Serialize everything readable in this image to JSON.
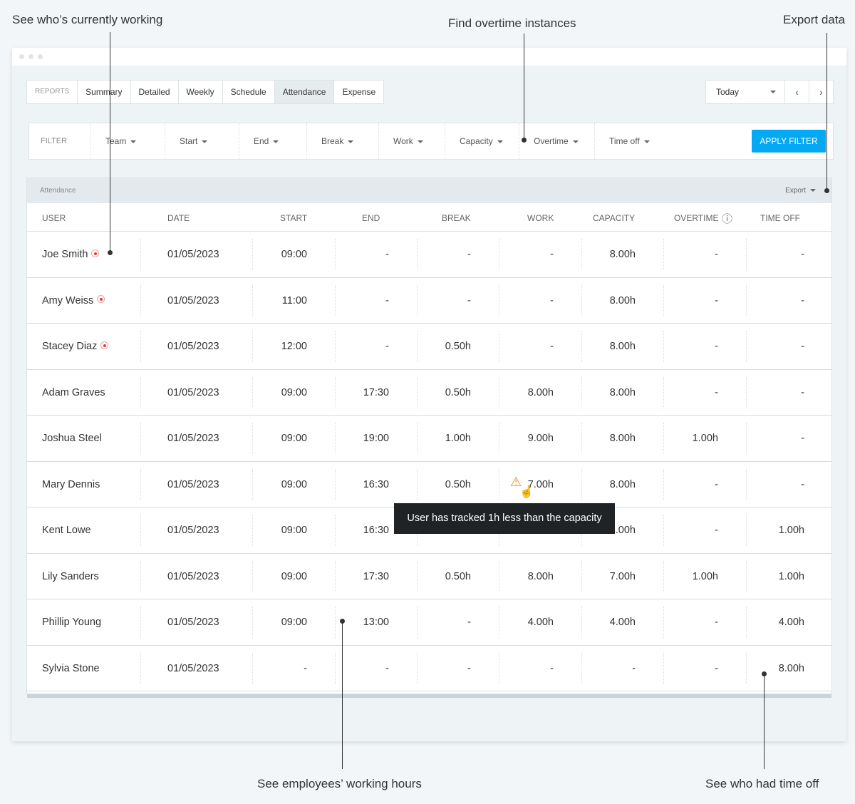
{
  "annotations": {
    "working": "See who’s currently working",
    "overtime": "Find overtime instances",
    "export": "Export data",
    "hours": "See employees’ working hours",
    "timeoff": "See who had time off"
  },
  "tabs": {
    "label": "REPORTS",
    "items": [
      "Summary",
      "Detailed",
      "Weekly",
      "Schedule",
      "Attendance",
      "Expense"
    ],
    "active": "Attendance"
  },
  "date_picker": {
    "value": "Today",
    "prev": "‹",
    "next": "›"
  },
  "filter": {
    "label": "FILTER",
    "items": [
      "Team",
      "Start",
      "End",
      "Break",
      "Work",
      "Capacity",
      "Overtime",
      "Time off"
    ],
    "apply": "APPLY FILTER",
    "accent": "#03a9f4"
  },
  "table": {
    "title": "Attendance",
    "export": "Export",
    "columns": [
      "USER",
      "DATE",
      "START",
      "END",
      "BREAK",
      "WORK",
      "CAPACITY",
      "OVERTIME",
      "TIME OFF"
    ],
    "rows": [
      {
        "user": "Joe Smith",
        "live": true,
        "cells": [
          "01/05/2023",
          "09:00",
          "-",
          "-",
          "-",
          "8.00h",
          "-",
          "-"
        ]
      },
      {
        "user": "Amy Weiss",
        "live": true,
        "cells": [
          "01/05/2023",
          "11:00",
          "-",
          "-",
          "-",
          "8.00h",
          "-",
          "-"
        ]
      },
      {
        "user": "Stacey Diaz",
        "live": true,
        "cells": [
          "01/05/2023",
          "12:00",
          "-",
          "0.50h",
          "-",
          "8.00h",
          "-",
          "-"
        ]
      },
      {
        "user": "Adam Graves",
        "live": false,
        "cells": [
          "01/05/2023",
          "09:00",
          "17:30",
          "0.50h",
          "8.00h",
          "8.00h",
          "-",
          "-"
        ]
      },
      {
        "user": "Joshua Steel",
        "live": false,
        "cells": [
          "01/05/2023",
          "09:00",
          "19:00",
          "1.00h",
          "9.00h",
          "8.00h",
          "1.00h",
          "-"
        ]
      },
      {
        "user": "Mary Dennis",
        "live": false,
        "cells": [
          "01/05/2023",
          "09:00",
          "16:30",
          "0.50h",
          "7.00h",
          "8.00h",
          "-",
          "-"
        ]
      },
      {
        "user": "Kent Lowe",
        "live": false,
        "cells": [
          "01/05/2023",
          "09:00",
          "16:30",
          "",
          "",
          "8.00h",
          "-",
          "1.00h"
        ]
      },
      {
        "user": "Lily Sanders",
        "live": false,
        "cells": [
          "01/05/2023",
          "09:00",
          "17:30",
          "0.50h",
          "8.00h",
          "7.00h",
          "1.00h",
          "1.00h"
        ]
      },
      {
        "user": "Phillip Young",
        "live": false,
        "cells": [
          "01/05/2023",
          "09:00",
          "13:00",
          "-",
          "4.00h",
          "4.00h",
          "-",
          "4.00h"
        ]
      },
      {
        "user": "Sylvia Stone",
        "live": false,
        "cells": [
          "01/05/2023",
          "-",
          "-",
          "-",
          "-",
          "-",
          "-",
          "8.00h"
        ]
      }
    ]
  },
  "tooltip": "User has tracked 1h less than the capacity",
  "icons": {
    "warning": "warning-triangle-icon",
    "live": "live-indicator-icon",
    "info": "info-icon",
    "cursor": "hand-cursor-icon"
  }
}
